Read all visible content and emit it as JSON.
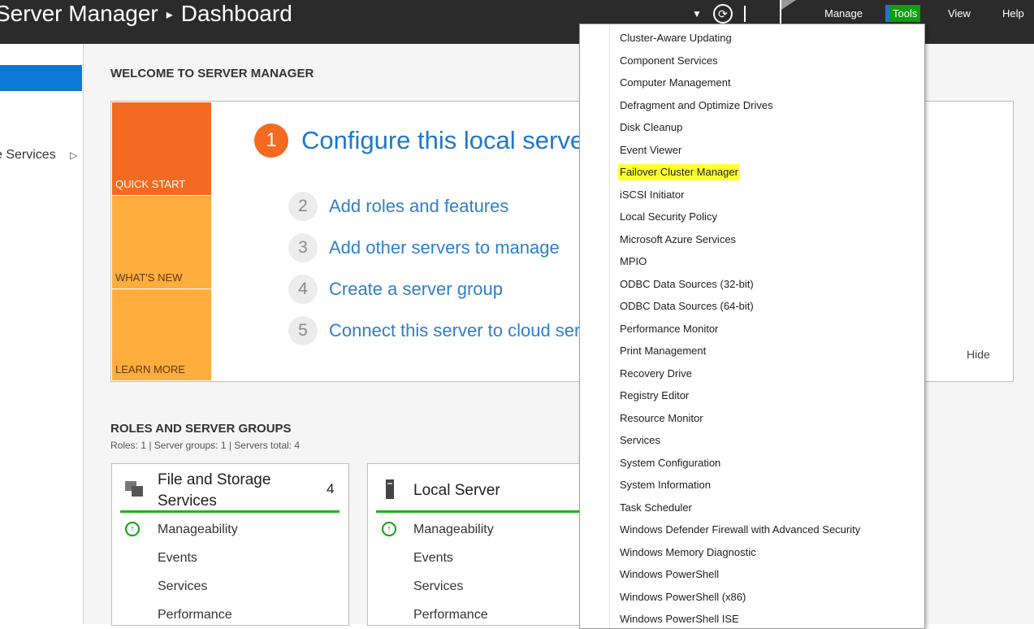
{
  "header": {
    "title_app": "Server Manager",
    "title_separator": "▸",
    "title_page": "Dashboard",
    "menu": {
      "manage": "Manage",
      "tools": "Tools",
      "view": "View",
      "help": "Help"
    }
  },
  "sidebar": {
    "item_services": "e Services",
    "arrow": "▷"
  },
  "welcome": {
    "heading": "WELCOME TO SERVER MANAGER",
    "tiles": {
      "quick_start": "QUICK START",
      "whats_new": "WHAT'S NEW",
      "learn_more": "LEARN MORE"
    },
    "steps": [
      {
        "num": "1",
        "label": "Configure this local server"
      },
      {
        "num": "2",
        "label": "Add roles and features"
      },
      {
        "num": "3",
        "label": "Add other servers to manage"
      },
      {
        "num": "4",
        "label": "Create a server group"
      },
      {
        "num": "5",
        "label": "Connect this server to cloud ser"
      }
    ],
    "hide": "Hide"
  },
  "roles": {
    "heading": "ROLES AND SERVER GROUPS",
    "summary": "Roles: 1  |  Server groups: 1  |  Servers total: 4",
    "cards": [
      {
        "title": "File and Storage Services",
        "count": "4",
        "rows": [
          "Manageability",
          "Events",
          "Services",
          "Performance"
        ]
      },
      {
        "title": "Local Server",
        "count": "",
        "rows": [
          "Manageability",
          "Events",
          "Services",
          "Performance"
        ]
      }
    ]
  },
  "tools_menu": {
    "items": [
      "Cluster-Aware Updating",
      "Component Services",
      "Computer Management",
      "Defragment and Optimize Drives",
      "Disk Cleanup",
      "Event Viewer",
      "Failover Cluster Manager",
      "iSCSI Initiator",
      "Local Security Policy",
      "Microsoft Azure Services",
      "MPIO",
      "ODBC Data Sources (32-bit)",
      "ODBC Data Sources (64-bit)",
      "Performance Monitor",
      "Print Management",
      "Recovery Drive",
      "Registry Editor",
      "Resource Monitor",
      "Services",
      "System Configuration",
      "System Information",
      "Task Scheduler",
      "Windows Defender Firewall with Advanced Security",
      "Windows Memory Diagnostic",
      "Windows PowerShell",
      "Windows PowerShell (x86)",
      "Windows PowerShell ISE"
    ],
    "highlighted_item": "Failover Cluster Manager",
    "highlight_color": "#ffff2e"
  },
  "colors": {
    "header_bg": "#2b2b2b",
    "accent_blue": "#0a78d4",
    "quick_start": "#f36a20",
    "tile_secondary": "#ffad3d",
    "status_green": "#1db31d",
    "tools_menu_active": "#0e9e0e"
  },
  "icons": [
    "refresh-icon",
    "flag-icon",
    "caret-down-icon",
    "storage-icon",
    "server-icon",
    "status-ok-icon"
  ]
}
